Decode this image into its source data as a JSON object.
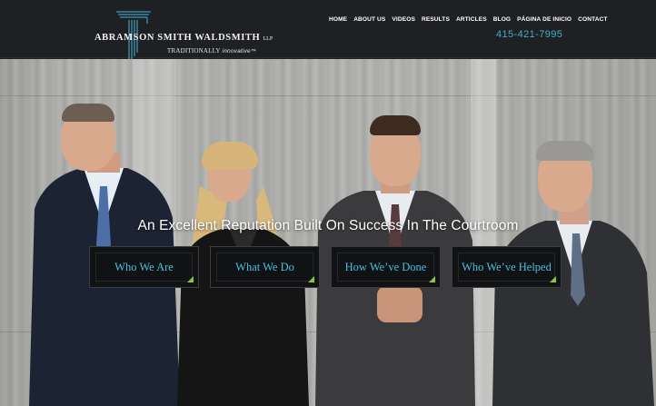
{
  "header": {
    "logo": {
      "name_part1": "ABRAMSON",
      "name_part2": "SMITH",
      "name_part3": "WALDSMITH",
      "llp": "LLP",
      "tagline_traditionally": "TRADITIONALLY",
      "tagline_innovative": "innovative",
      "tagline_tm": "™"
    },
    "nav": [
      {
        "label": "HOME"
      },
      {
        "label": "ABOUT US"
      },
      {
        "label": "VIDEOS"
      },
      {
        "label": "RESULTS"
      },
      {
        "label": "ARTICLES"
      },
      {
        "label": "BLOG"
      },
      {
        "label": "PÁGINA DE INICIO"
      },
      {
        "label": "CONTACT"
      }
    ],
    "phone": "415-421-7995"
  },
  "hero": {
    "headline": "An Excellent Reputation Built On Success In The Courtroom",
    "buttons": [
      {
        "label": "Who We Are"
      },
      {
        "label": "What We Do"
      },
      {
        "label": "How We’ve Done"
      },
      {
        "label": "Who We’ve Helped"
      }
    ]
  },
  "colors": {
    "header_bg": "#1f2023",
    "accent_blue": "#46c0e0",
    "phone_blue": "#3fb0cc",
    "corner_green": "#8cc63e",
    "button_bg": "#111214"
  }
}
